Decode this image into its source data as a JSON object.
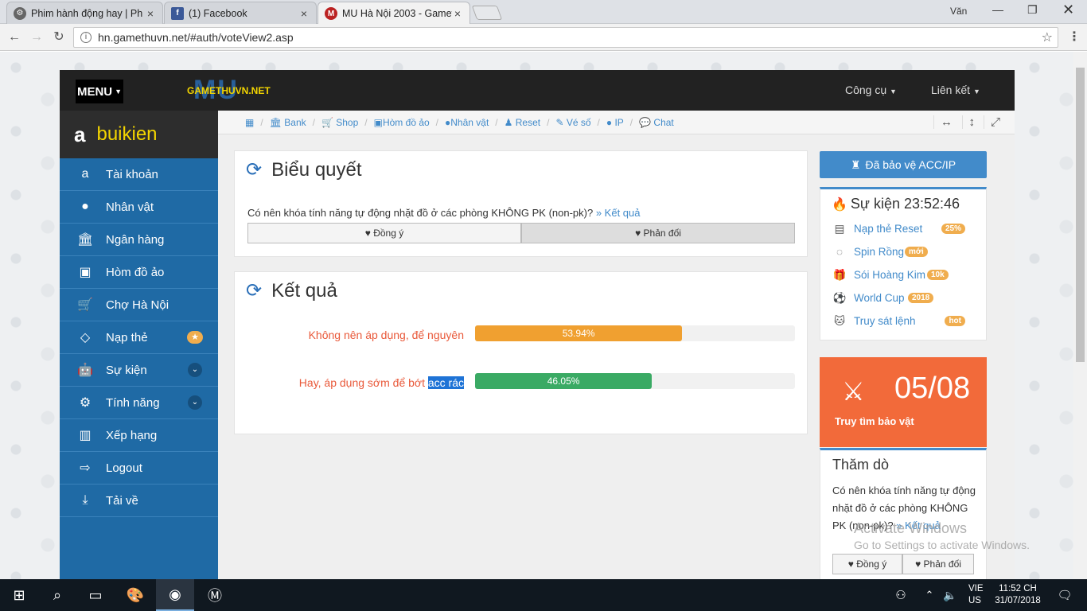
{
  "browser": {
    "tabs": [
      {
        "title": "Phim hành động hay | Ph",
        "icon": "film-site-icon"
      },
      {
        "title": "(1) Facebook",
        "icon": "facebook-icon"
      },
      {
        "title": "MU Hà Nội 2003 - Gamet",
        "icon": "mu-game-icon"
      }
    ],
    "user": "Văn",
    "url": "hn.gamethuvn.net/#auth/voteView2.asp"
  },
  "header": {
    "menu_label": "MENU",
    "logo_text": "GAMETHUVN.NET",
    "logo_bg": "MU",
    "tools": "Công cụ",
    "links": "Liên kết"
  },
  "sidebar": {
    "username": "buikien",
    "items": [
      {
        "label": "Tài khoản",
        "icon": "amazon-icon"
      },
      {
        "label": "Nhân vật",
        "icon": "user-icon"
      },
      {
        "label": "Ngân hàng",
        "icon": "bank-icon"
      },
      {
        "label": "Hòm đồ ảo",
        "icon": "briefcase-icon"
      },
      {
        "label": "Chợ Hà Nội",
        "icon": "cart-icon"
      },
      {
        "label": "Nạp thẻ",
        "icon": "diamond-icon",
        "badge": "★"
      },
      {
        "label": "Sự kiện",
        "icon": "android-icon",
        "badge": "⌄"
      },
      {
        "label": "Tính năng",
        "icon": "gears-icon",
        "badge": "⌄"
      },
      {
        "label": "Xếp hạng",
        "icon": "chart-icon"
      },
      {
        "label": "Logout",
        "icon": "signout-icon"
      },
      {
        "label": "Tải về",
        "icon": "download-icon"
      }
    ]
  },
  "breadcrumb": [
    "Bank",
    "Shop",
    "Hòm đồ ảo",
    "Nhân vật",
    "Reset",
    "Vé số",
    "IP",
    "Chat"
  ],
  "vote": {
    "title": "Biểu quyết",
    "question": "Có nên khóa tính năng tự động nhặt đồ ở các phòng KHÔNG PK (non-pk)?",
    "result_link": "» Kết quả",
    "agree": "Đồng ý",
    "disagree": "Phản đối"
  },
  "results": {
    "title": "Kết quả",
    "rows": [
      {
        "label": "Không nên áp dụng, để nguyên",
        "percent_text": "53.94%",
        "value": 53.94,
        "color": "#f0a030"
      },
      {
        "label": "Hay, áp dụng sớm để bớt ",
        "label_sel": "acc rác",
        "percent_text": "46.05%",
        "value": 46.05,
        "color": "#3aaa64"
      }
    ]
  },
  "right": {
    "protect_btn": "Đã bảo vệ ACC/IP",
    "event_title": "Sự kiện 23:52:46",
    "events": [
      {
        "label": "Nạp thẻ Reset",
        "badge": "25%",
        "icon": "money-icon"
      },
      {
        "label": "Spin Rồng",
        "badge": "mới",
        "icon": "spinner-icon"
      },
      {
        "label": "Sói Hoàng Kim",
        "badge": "10k",
        "icon": "gift-icon"
      },
      {
        "label": "World Cup",
        "badge": "2018",
        "icon": "soccer-ball-icon"
      },
      {
        "label": "Truy sát lệnh",
        "badge": "hot",
        "icon": "github-icon"
      }
    ],
    "treasure_date": "05/08",
    "treasure_label": "Truy tìm bảo vật",
    "poll_title": "Thăm dò",
    "poll_text": "Có nên khóa tính năng tự động nhặt đồ ở các phòng KHÔNG PK (non-pk)?",
    "poll_result": "» Kết quả",
    "poll_agree": "Đồng ý",
    "poll_disagree": "Phản đối"
  },
  "watermark": {
    "line1": "Activate Windows",
    "line2": "Go to Settings to activate Windows."
  },
  "taskbar": {
    "lang1": "VIE",
    "lang2": "US",
    "time": "11:52 CH",
    "date": "31/07/2018"
  }
}
